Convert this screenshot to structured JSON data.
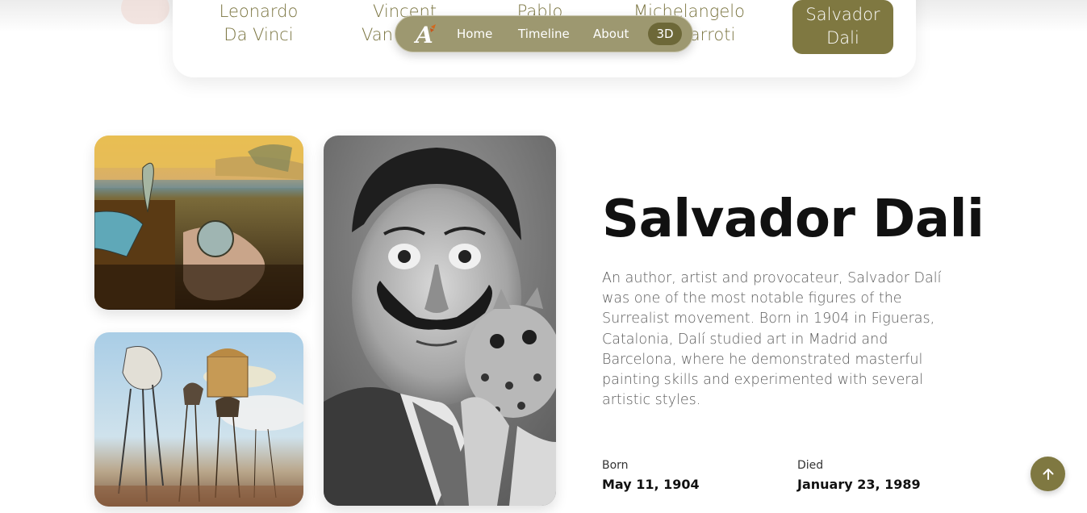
{
  "artist_tabs": [
    {
      "line1": "Leonardo",
      "line2": "Da Vinci",
      "active": false
    },
    {
      "line1": "Vincent",
      "line2": "Van",
      "active": false
    },
    {
      "line1": "Pablo",
      "line2": "",
      "active": false
    },
    {
      "line1": "Michelangelo",
      "line2": "arroti",
      "active": false
    },
    {
      "line1": "Salvador",
      "line2": "Dali",
      "active": true
    }
  ],
  "nav": {
    "logo_letter": "A",
    "links": [
      "Home",
      "Timeline",
      "About"
    ],
    "badge": "3D"
  },
  "artist": {
    "name": "Salvador Dali",
    "bio": "An author, artist and provocateur, Salvador Dalí was one of the most notable figures of the Surrealist movement. Born in 1904 in Figueras, Catalonia, Dalí studied art in Madrid and Barcelona, where he demonstrated masterful painting skills and experimented with several artistic styles.",
    "born_label": "Born",
    "born_value": "May 11, 1904",
    "died_label": "Died",
    "died_value": "January 23, 1989"
  },
  "images": {
    "painting1": "persistence-of-memory-painting",
    "painting2": "temptation-of-st-anthony-painting",
    "portrait": "salvador-dali-portrait-photo"
  },
  "colors": {
    "accent": "#7f7841",
    "nav_pill": "#9d9870",
    "tab_text": "#7b7541"
  }
}
